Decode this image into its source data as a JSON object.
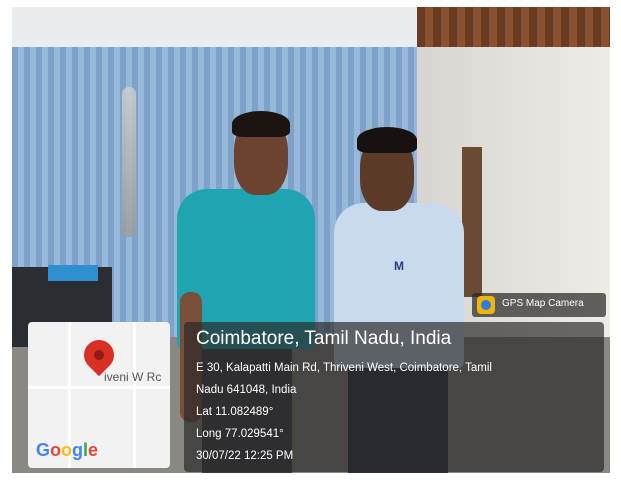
{
  "overlay": {
    "badge_label": "GPS Map Camera",
    "location_title": "Coimbatore, Tamil Nadu, India",
    "address_line1": "E 30, Kalapatti Main Rd, Thriveni West, Coimbatore, Tamil",
    "address_line2": "Nadu 641048, India",
    "latitude": "Lat 11.082489°",
    "longitude": "Long 77.029541°",
    "timestamp": "30/07/22 12:25 PM"
  },
  "map": {
    "street_label": "iveni W Rc",
    "provider": "Google",
    "pin_color": "#d93025"
  },
  "shirt_logo": "M",
  "colors": {
    "overlay_bg": "#282828",
    "teal_shirt": "#1fa4b2",
    "blue_wall": "#7fa3c8"
  }
}
